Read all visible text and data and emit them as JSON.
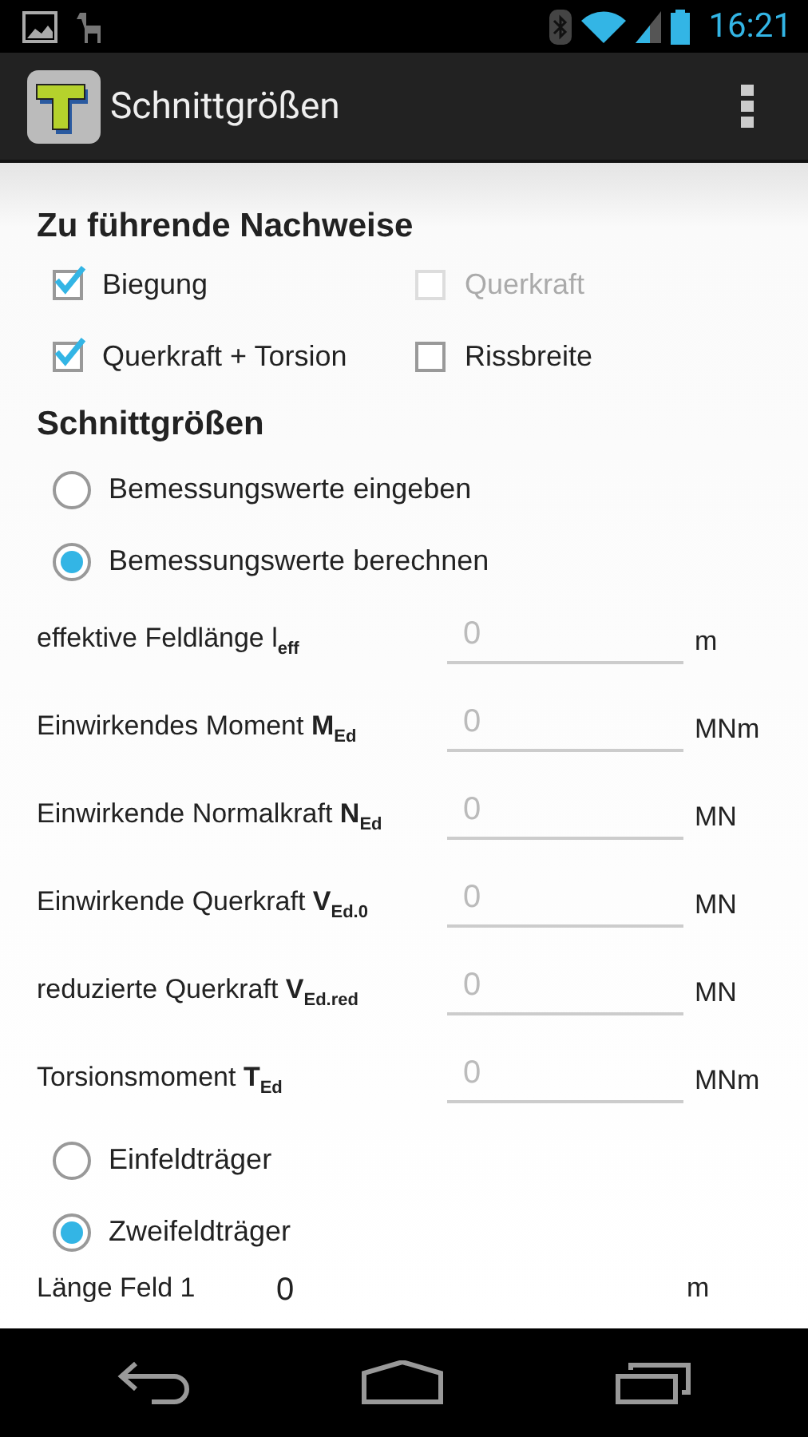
{
  "status_bar": {
    "time": "16:21"
  },
  "app_bar": {
    "title": "Schnittgrößen"
  },
  "checks_section": {
    "title": "Zu führende Nachweise",
    "checks": [
      {
        "label": "Biegung",
        "checked": true,
        "disabled": false
      },
      {
        "label": "Querkraft",
        "checked": false,
        "disabled": true
      },
      {
        "label": "Querkraft + Torsion",
        "checked": true,
        "disabled": false
      },
      {
        "label": "Rissbreite",
        "checked": false,
        "disabled": false
      }
    ]
  },
  "forces_section": {
    "title": "Schnittgrößen",
    "mode_options": [
      {
        "label": "Bemessungswerte eingeben",
        "selected": false
      },
      {
        "label": "Bemessungswerte berechnen",
        "selected": true
      }
    ],
    "fields": [
      {
        "label": "effektive Feldlänge l$_{eff}$",
        "placeholder": "0",
        "unit": "m"
      },
      {
        "label": "Einwirkendes Moment **M**$_{Ed}$",
        "placeholder": "0",
        "unit": "MNm"
      },
      {
        "label": "Einwirkende Normalkraft **N**$_{Ed}$",
        "placeholder": "0",
        "unit": "MN"
      },
      {
        "label": "Einwirkende Querkraft **V**$_{Ed.0}$",
        "placeholder": "0",
        "unit": "MN"
      },
      {
        "label": "reduzierte Querkraft **V**$_{Ed.red}$",
        "placeholder": "0",
        "unit": "MN"
      },
      {
        "label": "Torsionsmoment **T**$_{Ed}$",
        "placeholder": "0",
        "unit": "MNm"
      }
    ],
    "beam_options": [
      {
        "label": "Einfeldträger",
        "selected": false
      },
      {
        "label": "Zweifeldträger",
        "selected": true
      }
    ],
    "span_fields": [
      {
        "label": "Länge Feld 1",
        "value": "0",
        "unit": "m"
      }
    ]
  }
}
